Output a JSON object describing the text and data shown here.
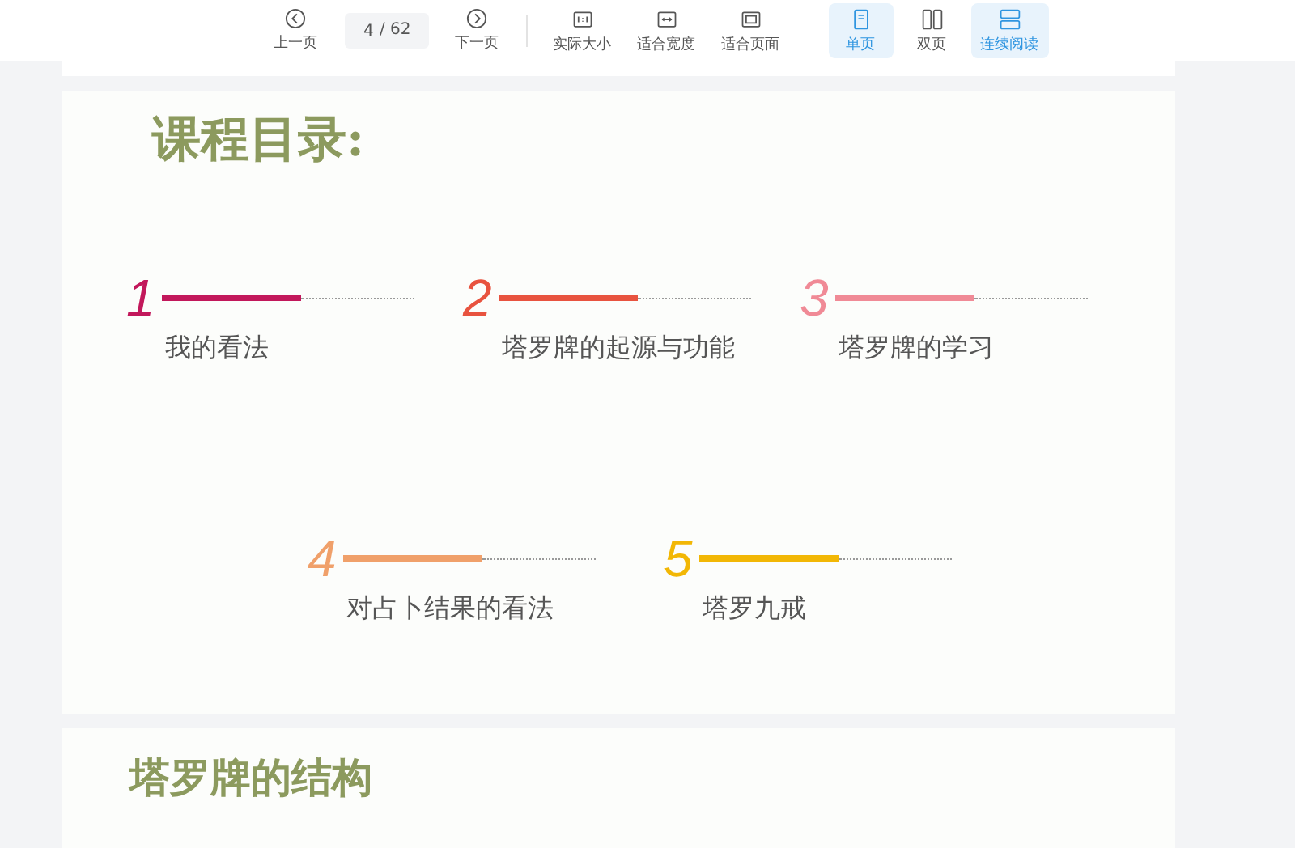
{
  "toolbar": {
    "prev": {
      "label": "上一页"
    },
    "page_field": {
      "value": "4",
      "total": "/ 62"
    },
    "next": {
      "label": "下一页"
    },
    "fit_buttons": [
      {
        "kind": "actual",
        "label": "实际大小"
      },
      {
        "kind": "width",
        "label": "适合宽度"
      },
      {
        "kind": "page",
        "label": "适合页面"
      }
    ],
    "view_modes": [
      {
        "kind": "single",
        "label": "单页",
        "selected": true
      },
      {
        "kind": "double",
        "label": "双页",
        "selected": false
      },
      {
        "kind": "continuous",
        "label": "连续阅读",
        "selected": true
      }
    ]
  },
  "pages": [
    {
      "heading": "课程目录:",
      "rows": [
        [
          {
            "number": "1",
            "label": "我的看法",
            "color": "#c2185b"
          },
          {
            "number": "2",
            "label": "塔罗牌的起源与功能",
            "color": "#e8533f"
          },
          {
            "number": "3",
            "label": "塔罗牌的学习",
            "color": "#f08a96"
          }
        ],
        [
          {
            "number": "4",
            "label": "对占卜结果的看法",
            "color": "#f0a06a"
          },
          {
            "number": "5",
            "label": "塔罗九戒",
            "color": "#f2b705"
          }
        ]
      ]
    },
    {
      "heading": "塔罗牌的结构"
    }
  ]
}
